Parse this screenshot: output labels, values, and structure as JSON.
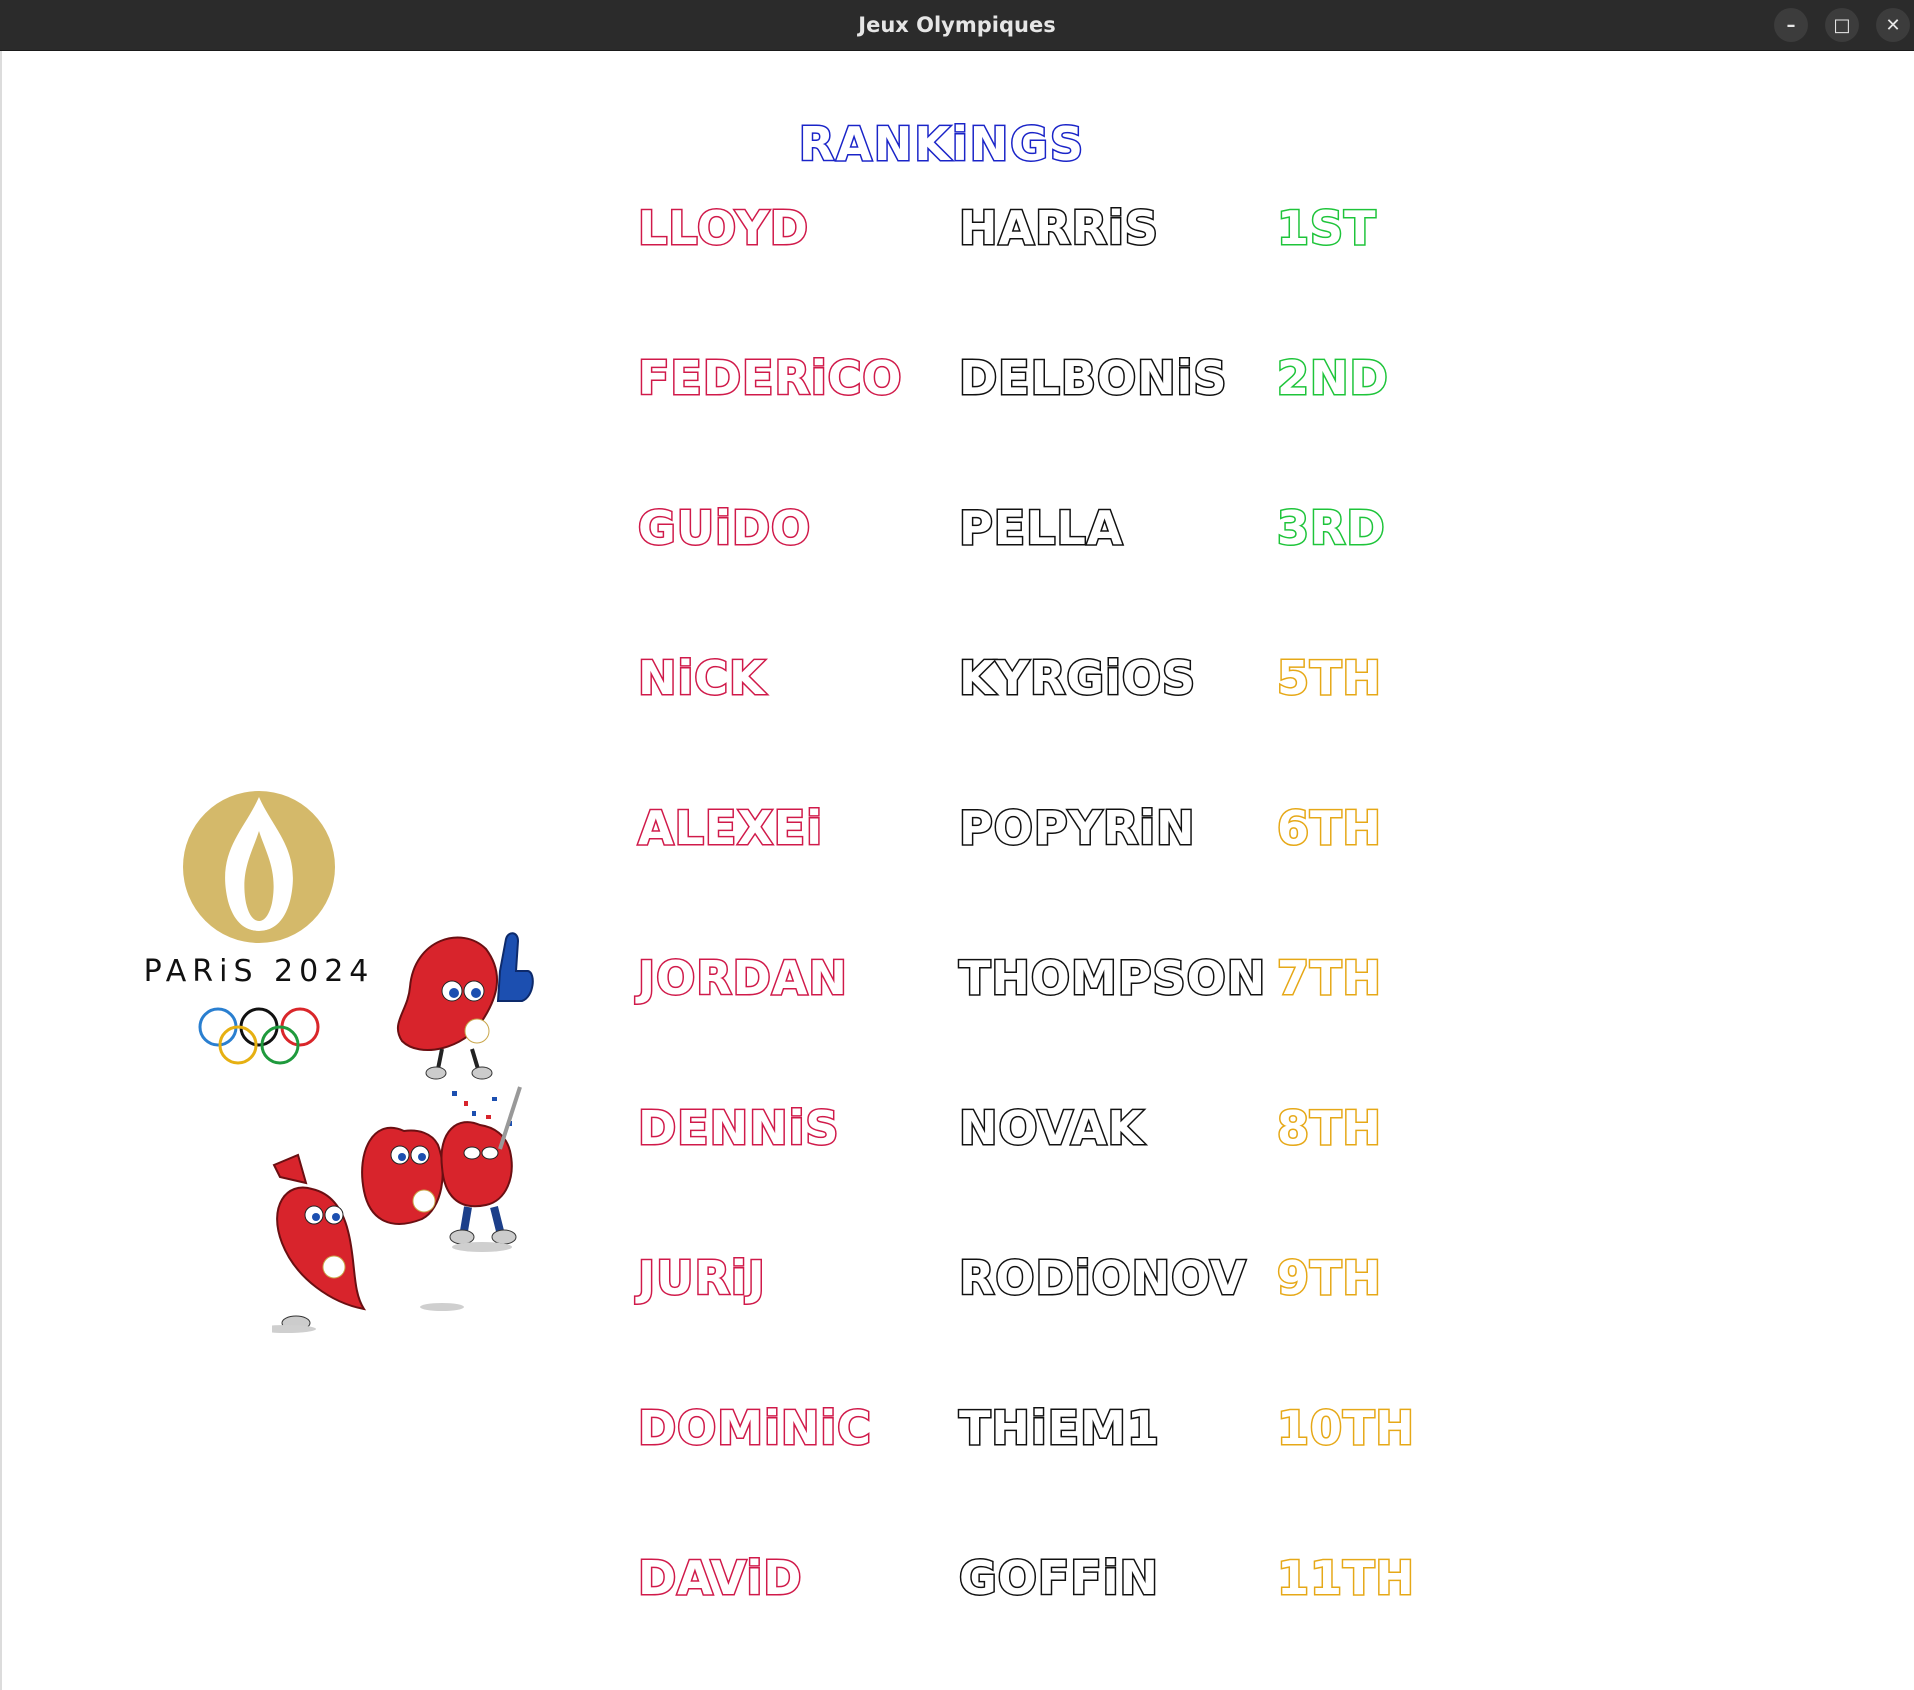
{
  "window": {
    "title": "Jeux Olympiques",
    "controls": {
      "minimize": "–",
      "maximize": "□",
      "close": "✕"
    }
  },
  "heading": "RANKiNGS",
  "logo": {
    "caption": "PARiS 2024"
  },
  "rankings": [
    {
      "first": "LLOYD",
      "last": "HARRiS",
      "place": "1ST"
    },
    {
      "first": "FEDERiCO",
      "last": "DELBONiS",
      "place": "2ND"
    },
    {
      "first": "GUiDO",
      "last": "PELLA",
      "place": "3RD"
    },
    {
      "first": "NiCK",
      "last": "KYRGiOS",
      "place": "5TH"
    },
    {
      "first": "ALEXEi",
      "last": "POPYRiN",
      "place": "6TH"
    },
    {
      "first": "JORDAN",
      "last": "THOMPSON",
      "place": "7TH"
    },
    {
      "first": "DENNiS",
      "last": "NOVAK",
      "place": "8TH"
    },
    {
      "first": "JURiJ",
      "last": "RODiONOV",
      "place": "9TH"
    },
    {
      "first": "DOMiNiC",
      "last": "THiEM1",
      "place": "10TH"
    },
    {
      "first": "DAViD",
      "last": "GOFFiN",
      "place": "11TH"
    }
  ],
  "colors": {
    "first_name_outline": "#d01a4a",
    "last_name_outline": "#111111",
    "podium_outline": "#1ec43a",
    "place_outline": "#e6a817",
    "heading_outline": "#1a24c8",
    "logo_gold": "#d4b96a"
  }
}
